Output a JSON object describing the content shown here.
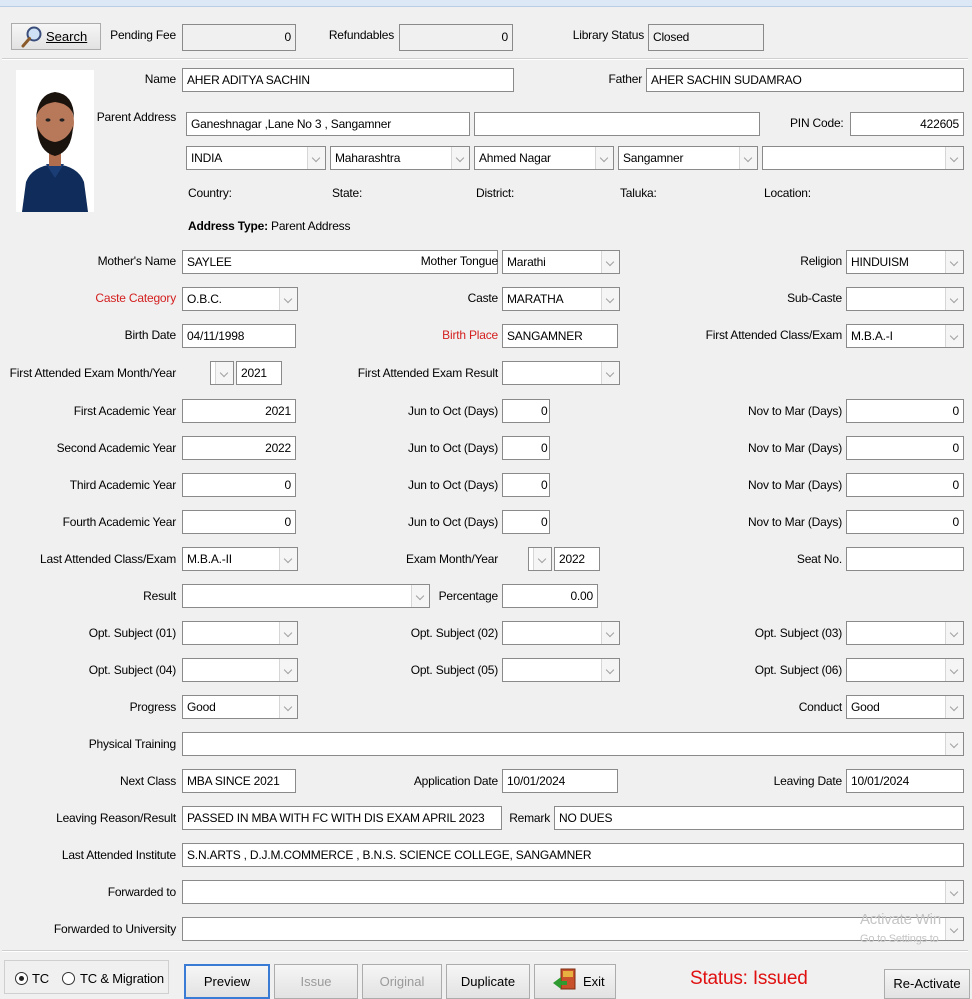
{
  "top": {
    "search_label": "Search",
    "pending_fee_label": "Pending Fee",
    "pending_fee_value": "0",
    "refundables_label": "Refundables",
    "refundables_value": "0",
    "library_status_label": "Library Status",
    "library_status_value": "Closed"
  },
  "student": {
    "name_label": "Name",
    "name": "AHER ADITYA SACHIN",
    "father_label": "Father",
    "father": "AHER SACHIN SUDAMRAO",
    "parent_address_label": "Parent Address",
    "address_line1": "Ganeshnagar ,Lane No 3 , Sangamner",
    "address_line2": "",
    "pin_label": "PIN Code:",
    "pin": "422605",
    "country": "INDIA",
    "state": "Maharashtra",
    "district": "Ahmed Nagar",
    "taluka": "Sangamner",
    "location": "",
    "country_label": "Country:",
    "state_label": "State:",
    "district_label": "District:",
    "taluka_label": "Taluka:",
    "location_label": "Location:",
    "address_type_label": "Address Type:",
    "address_type": "Parent Address"
  },
  "details": {
    "mothers_name_label": "Mother's Name",
    "mothers_name": "SAYLEE",
    "mother_tongue_label": "Mother Tongue",
    "mother_tongue": "Marathi",
    "religion_label": "Religion",
    "religion": "HINDUISM",
    "caste_category_label": "Caste Category",
    "caste_category": "O.B.C.",
    "caste_label": "Caste",
    "caste": "MARATHA",
    "sub_caste_label": "Sub-Caste",
    "sub_caste": "",
    "birth_date_label": "Birth Date",
    "birth_date": "04/11/1998",
    "birth_place_label": "Birth Place",
    "birth_place": "SANGAMNER",
    "first_class_label": "First Attended Class/Exam",
    "first_class": "M.B.A.-I",
    "first_exam_my_label": "First Attended Exam Month/Year",
    "first_exam_month": "",
    "first_exam_year": "2021",
    "first_exam_result_label": "First Attended Exam Result",
    "first_exam_result": ""
  },
  "academic_years": [
    {
      "label": "First Academic Year",
      "year": "2021",
      "jun_label": "Jun to Oct (Days)",
      "jun": "0",
      "nov_label": "Nov to Mar (Days)",
      "nov": "0"
    },
    {
      "label": "Second Academic Year",
      "year": "2022",
      "jun_label": "Jun to Oct (Days)",
      "jun": "0",
      "nov_label": "Nov to Mar (Days)",
      "nov": "0"
    },
    {
      "label": "Third Academic Year",
      "year": "0",
      "jun_label": "Jun to Oct (Days)",
      "jun": "0",
      "nov_label": "Nov to Mar (Days)",
      "nov": "0"
    },
    {
      "label": "Fourth Academic Year",
      "year": "0",
      "jun_label": "Jun to Oct (Days)",
      "jun": "0",
      "nov_label": "Nov to Mar (Days)",
      "nov": "0"
    }
  ],
  "exam": {
    "last_class_label": "Last Attended Class/Exam",
    "last_class": "M.B.A.-II",
    "exam_my_label": "Exam Month/Year",
    "exam_month": "",
    "exam_year": "2022",
    "seat_no_label": "Seat No.",
    "seat_no": "",
    "result_label": "Result",
    "result": "",
    "percentage_label": "Percentage",
    "percentage": "0.00",
    "opt1_label": "Opt. Subject (01)",
    "opt2_label": "Opt. Subject (02)",
    "opt3_label": "Opt. Subject (03)",
    "opt4_label": "Opt. Subject (04)",
    "opt5_label": "Opt. Subject (05)",
    "opt6_label": "Opt. Subject (06)",
    "progress_label": "Progress",
    "progress": "Good",
    "conduct_label": "Conduct",
    "conduct": "Good",
    "physical_label": "Physical Training",
    "physical": ""
  },
  "leaving": {
    "next_class_label": "Next Class",
    "next_class": "MBA SINCE 2021",
    "application_date_label": "Application Date",
    "application_date": "10/01/2024",
    "leaving_date_label": "Leaving Date",
    "leaving_date": "10/01/2024",
    "reason_label": "Leaving Reason/Result",
    "reason": "PASSED IN MBA WITH FC WITH DIS EXAM APRIL 2023",
    "remark_label": "Remark",
    "remark": "NO DUES",
    "last_institute_label": "Last Attended Institute",
    "last_institute": "S.N.ARTS , D.J.M.COMMERCE , B.N.S. SCIENCE COLLEGE, SANGAMNER",
    "forwarded_to_label": "Forwarded to",
    "forwarded_to": "",
    "forwarded_univ_label": "Forwarded to University",
    "forwarded_univ": ""
  },
  "footer": {
    "tc_label": "TC",
    "tc_migration_label": "TC & Migration",
    "preview": "Preview",
    "issue": "Issue",
    "original": "Original",
    "duplicate": "Duplicate",
    "exit": "Exit",
    "status": "Status: Issued",
    "reactivate": "Re-Activate"
  },
  "watermark": {
    "line1": "Activate Win",
    "line2": "Go to Settings to"
  },
  "colors": {
    "red_label": "#d41f1f",
    "status": "#e01010",
    "background": "#f0f0f0"
  },
  "icons": [
    "search-icon",
    "exit-icon",
    "student-photo"
  ]
}
